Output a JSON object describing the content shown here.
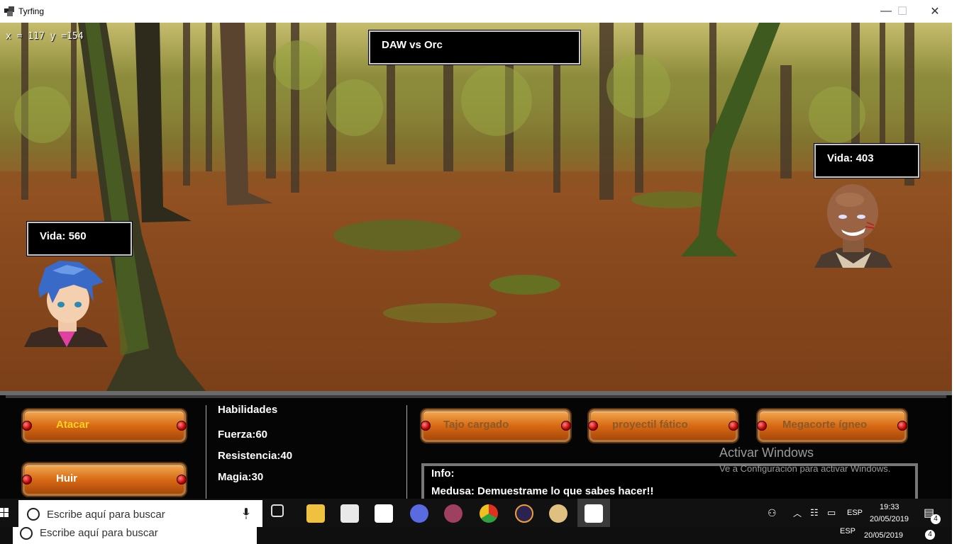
{
  "window": {
    "title": "Tyrfing",
    "minimize_glyph": "—",
    "maximize_glyph": "☐",
    "close_glyph": "✕"
  },
  "hud": {
    "coords": "x = 117 y =154",
    "battle_title": "DAW vs Orc"
  },
  "player": {
    "life_label": "Vida: 560"
  },
  "enemy": {
    "life_label": "Vida: 403"
  },
  "actions": {
    "attack": "Atacar",
    "flee": "Huir"
  },
  "stats": {
    "heading": "Habilidades",
    "strength": "Fuerza:60",
    "resistance": "Resistencia:40",
    "magic": "Magia:30"
  },
  "skills": [
    "Tajo cargado",
    "proyectil fático",
    "Megacorte ígneo"
  ],
  "info": {
    "label": "Info:",
    "message": "Medusa: Demuestrame lo que sabes hacer!!"
  },
  "watermark": {
    "title": "Activar Windows",
    "subtitle": "Ve a Configuración para activar Windows."
  },
  "taskbar": {
    "search_placeholder": "Escribe aquí para buscar",
    "language": "ESP",
    "time": "19:33",
    "date": "20/05/2019",
    "notification_count": "4",
    "app_icons": [
      "task-view-icon",
      "file-explorer-icon",
      "mail-icon",
      "store-icon",
      "eclipse-like-icon",
      "game-icon",
      "chrome-icon",
      "eclipse-icon",
      "paint-icon",
      "tyrfing-app-icon"
    ]
  },
  "taskbar_shadow": {
    "search_placeholder": "Escribe aquí para buscar",
    "language": "ESP",
    "date": "20/05/2019",
    "notification_count": "4"
  },
  "colors": {
    "button_orange": "#d86a14",
    "active_label": "#ffd020",
    "disabled_label": "#8a5a28"
  }
}
